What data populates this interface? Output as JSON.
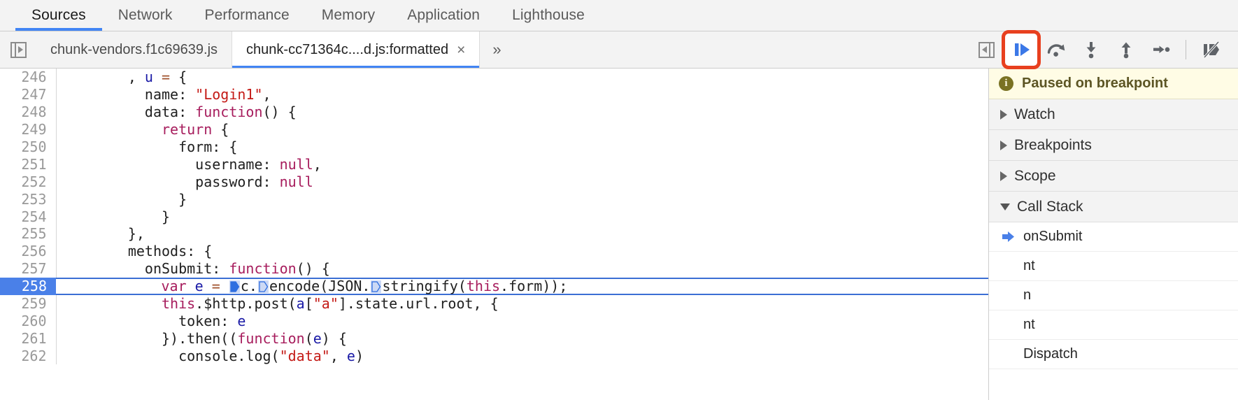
{
  "panel_tabs": [
    {
      "label": "Sources",
      "active": true
    },
    {
      "label": "Network",
      "active": false
    },
    {
      "label": "Performance",
      "active": false
    },
    {
      "label": "Memory",
      "active": false
    },
    {
      "label": "Application",
      "active": false
    },
    {
      "label": "Lighthouse",
      "active": false
    }
  ],
  "file_tabs": [
    {
      "label": "chunk-vendors.f1c69639.js",
      "active": false,
      "closable": false
    },
    {
      "label": "chunk-cc71364c....d.js:formatted",
      "active": true,
      "closable": true,
      "close_label": "×"
    }
  ],
  "tab_overflow_label": "»",
  "debugger_toolbar": {
    "show_navigator_title": "Show navigator",
    "buttons": [
      {
        "name": "resume-script-execution",
        "title": "Resume script execution",
        "highlighted": true
      },
      {
        "name": "step-over-next-function-call",
        "title": "Step over next function call",
        "highlighted": false
      },
      {
        "name": "step-into-next-function-call",
        "title": "Step into next function call",
        "highlighted": false
      },
      {
        "name": "step-out-of-current-function",
        "title": "Step out of current function",
        "highlighted": false
      },
      {
        "name": "step",
        "title": "Step",
        "highlighted": false
      },
      {
        "name": "deactivate-breakpoints",
        "title": "Deactivate breakpoints",
        "highlighted": false
      }
    ],
    "highlight_color": "#e8401f"
  },
  "editor": {
    "first_line": 246,
    "execution_line": 258,
    "lines": [
      {
        "num": 246,
        "tokens": [
          {
            "t": "        , ",
            "c": "plain"
          },
          {
            "t": "u",
            "c": "var"
          },
          {
            "t": " ",
            "c": "plain"
          },
          {
            "t": "=",
            "c": "op"
          },
          {
            "t": " {",
            "c": "plain"
          }
        ]
      },
      {
        "num": 247,
        "tokens": [
          {
            "t": "          name: ",
            "c": "plain"
          },
          {
            "t": "\"Login1\"",
            "c": "str"
          },
          {
            "t": ",",
            "c": "plain"
          }
        ]
      },
      {
        "num": 248,
        "tokens": [
          {
            "t": "          data: ",
            "c": "plain"
          },
          {
            "t": "function",
            "c": "key"
          },
          {
            "t": "() {",
            "c": "plain"
          }
        ]
      },
      {
        "num": 249,
        "tokens": [
          {
            "t": "            ",
            "c": "plain"
          },
          {
            "t": "return",
            "c": "key"
          },
          {
            "t": " {",
            "c": "plain"
          }
        ]
      },
      {
        "num": 250,
        "tokens": [
          {
            "t": "              form: {",
            "c": "plain"
          }
        ]
      },
      {
        "num": 251,
        "tokens": [
          {
            "t": "                username: ",
            "c": "plain"
          },
          {
            "t": "null",
            "c": "null"
          },
          {
            "t": ",",
            "c": "plain"
          }
        ]
      },
      {
        "num": 252,
        "tokens": [
          {
            "t": "                password: ",
            "c": "plain"
          },
          {
            "t": "null",
            "c": "null"
          }
        ]
      },
      {
        "num": 253,
        "tokens": [
          {
            "t": "              }",
            "c": "plain"
          }
        ]
      },
      {
        "num": 254,
        "tokens": [
          {
            "t": "            }",
            "c": "plain"
          }
        ]
      },
      {
        "num": 255,
        "tokens": [
          {
            "t": "        },",
            "c": "plain"
          }
        ]
      },
      {
        "num": 256,
        "tokens": [
          {
            "t": "        methods: {",
            "c": "plain"
          }
        ]
      },
      {
        "num": 257,
        "tokens": [
          {
            "t": "          onSubmit: ",
            "c": "plain"
          },
          {
            "t": "function",
            "c": "key"
          },
          {
            "t": "() {",
            "c": "plain"
          }
        ]
      },
      {
        "num": 258,
        "exec": true,
        "tokens": [
          {
            "t": "            ",
            "c": "plain"
          },
          {
            "t": "var",
            "c": "key"
          },
          {
            "t": " ",
            "c": "plain"
          },
          {
            "t": "e",
            "c": "var"
          },
          {
            "t": " ",
            "c": "plain"
          },
          {
            "t": "=",
            "c": "op"
          },
          {
            "t": " ",
            "c": "plain"
          },
          {
            "m": "step-marker-filled"
          },
          {
            "t": "c",
            "c": "plain"
          },
          {
            "t": ".",
            "c": "plain"
          },
          {
            "m": "step-marker-outline"
          },
          {
            "t": "encode(JSON.",
            "c": "plain"
          },
          {
            "m": "step-marker-outline"
          },
          {
            "t": "stringify(",
            "c": "plain"
          },
          {
            "t": "this",
            "c": "key"
          },
          {
            "t": ".form));",
            "c": "plain"
          }
        ]
      },
      {
        "num": 259,
        "tokens": [
          {
            "t": "            ",
            "c": "plain"
          },
          {
            "t": "this",
            "c": "key"
          },
          {
            "t": ".$http.post(",
            "c": "plain"
          },
          {
            "t": "a",
            "c": "var"
          },
          {
            "t": "[",
            "c": "plain"
          },
          {
            "t": "\"a\"",
            "c": "str"
          },
          {
            "t": "].state.url.root, {",
            "c": "plain"
          }
        ]
      },
      {
        "num": 260,
        "tokens": [
          {
            "t": "              token: ",
            "c": "plain"
          },
          {
            "t": "e",
            "c": "var"
          }
        ]
      },
      {
        "num": 261,
        "tokens": [
          {
            "t": "            }).then((",
            "c": "plain"
          },
          {
            "t": "function",
            "c": "key"
          },
          {
            "t": "(",
            "c": "plain"
          },
          {
            "t": "e",
            "c": "var"
          },
          {
            "t": ") {",
            "c": "plain"
          }
        ]
      },
      {
        "num": 262,
        "tokens": [
          {
            "t": "              console.log(",
            "c": "plain"
          },
          {
            "t": "\"data\"",
            "c": "str"
          },
          {
            "t": ", ",
            "c": "plain"
          },
          {
            "t": "e",
            "c": "var"
          },
          {
            "t": ")",
            "c": "plain"
          }
        ]
      }
    ]
  },
  "sidebar": {
    "paused_banner": {
      "text": "Paused on breakpoint",
      "icon": "info-icon",
      "glyph": "i"
    },
    "sections": [
      {
        "label": "Watch",
        "expanded": false
      },
      {
        "label": "Breakpoints",
        "expanded": false
      },
      {
        "label": "Scope",
        "expanded": false
      },
      {
        "label": "Call Stack",
        "expanded": true
      }
    ],
    "call_stack": [
      {
        "label": "onSubmit",
        "current": true
      },
      {
        "label": "nt",
        "current": false
      },
      {
        "label": "n",
        "current": false
      },
      {
        "label": "nt",
        "current": false
      },
      {
        "label": "Dispatch",
        "current": false
      }
    ]
  }
}
